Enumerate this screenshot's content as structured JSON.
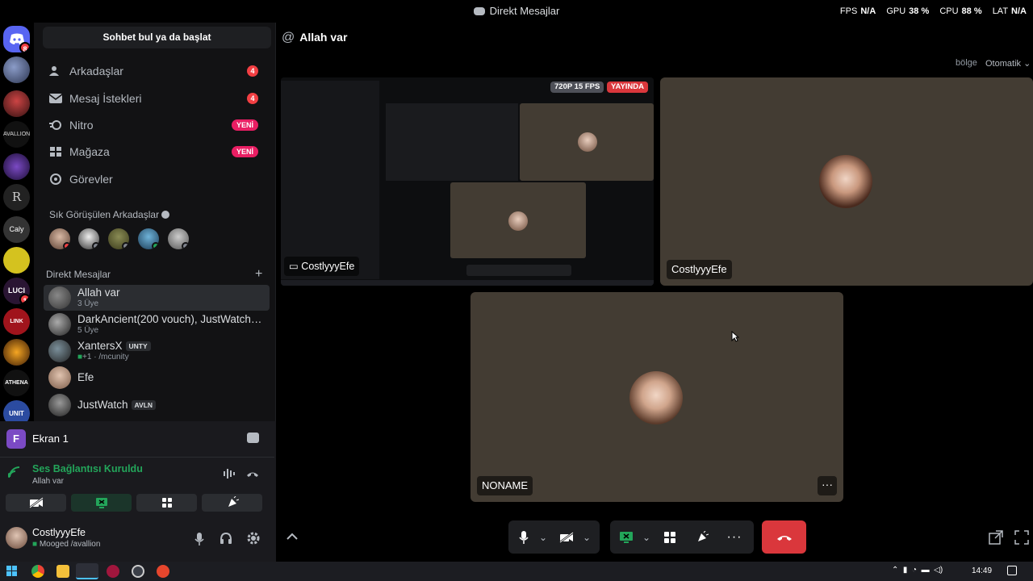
{
  "window": {
    "title": "Direkt Mesajlar"
  },
  "perf": {
    "fps_label": "FPS",
    "fps_val": "N/A",
    "gpu_label": "GPU",
    "gpu_val": "38 %",
    "cpu_label": "CPU",
    "cpu_val": "88 %",
    "lat_label": "LAT",
    "lat_val": "N/A"
  },
  "rail": {
    "home_badge": "8",
    "luci_badge": "1"
  },
  "sidebar": {
    "search": "Sohbet bul ya da başlat",
    "nav": [
      {
        "label": "Arkadaşlar",
        "badge": "4"
      },
      {
        "label": "Mesaj İstekleri",
        "badge": "4"
      },
      {
        "label": "Nitro",
        "badge": "YENİ"
      },
      {
        "label": "Mağaza",
        "badge": "YENİ"
      },
      {
        "label": "Görevler"
      }
    ],
    "frequent_title": "Sık Görüşülen Arkadaşlar",
    "dm_title": "Direkt Mesajlar",
    "dms": [
      {
        "name": "Allah var",
        "sub": "3 Üye"
      },
      {
        "name": "DarkAncient(200 vouch), JustWatch, ...",
        "sub": "5 Üye"
      },
      {
        "name": "XantersX",
        "tag": "UNTY",
        "sub": "+1 · /mcunity"
      },
      {
        "name": "Efe"
      },
      {
        "name": "JustWatch",
        "tag": "AVLN"
      }
    ]
  },
  "panel": {
    "screen_title": "Ekran 1",
    "screen_letter": "F",
    "voice_status": "Ses Bağlantısı Kuruldu",
    "voice_channel": "Allah var",
    "user_name": "CostlyyyEfe",
    "user_status": "Mooged /avallion"
  },
  "main": {
    "channel_name": "Allah var",
    "region_label": "bölge",
    "region_value": "Otomatik",
    "stream_quality": "720P 15 FPS",
    "stream_live": "YAYINDA",
    "stream_user": "CostlyyyEfe",
    "tile_user": "CostlyyyEfe",
    "tile_noname": "NONAME"
  },
  "taskbar": {
    "time": "14:49"
  },
  "colors": {
    "accent": "#5865f2",
    "danger": "#da373c",
    "green": "#23a55a",
    "tile": "#433c33"
  }
}
